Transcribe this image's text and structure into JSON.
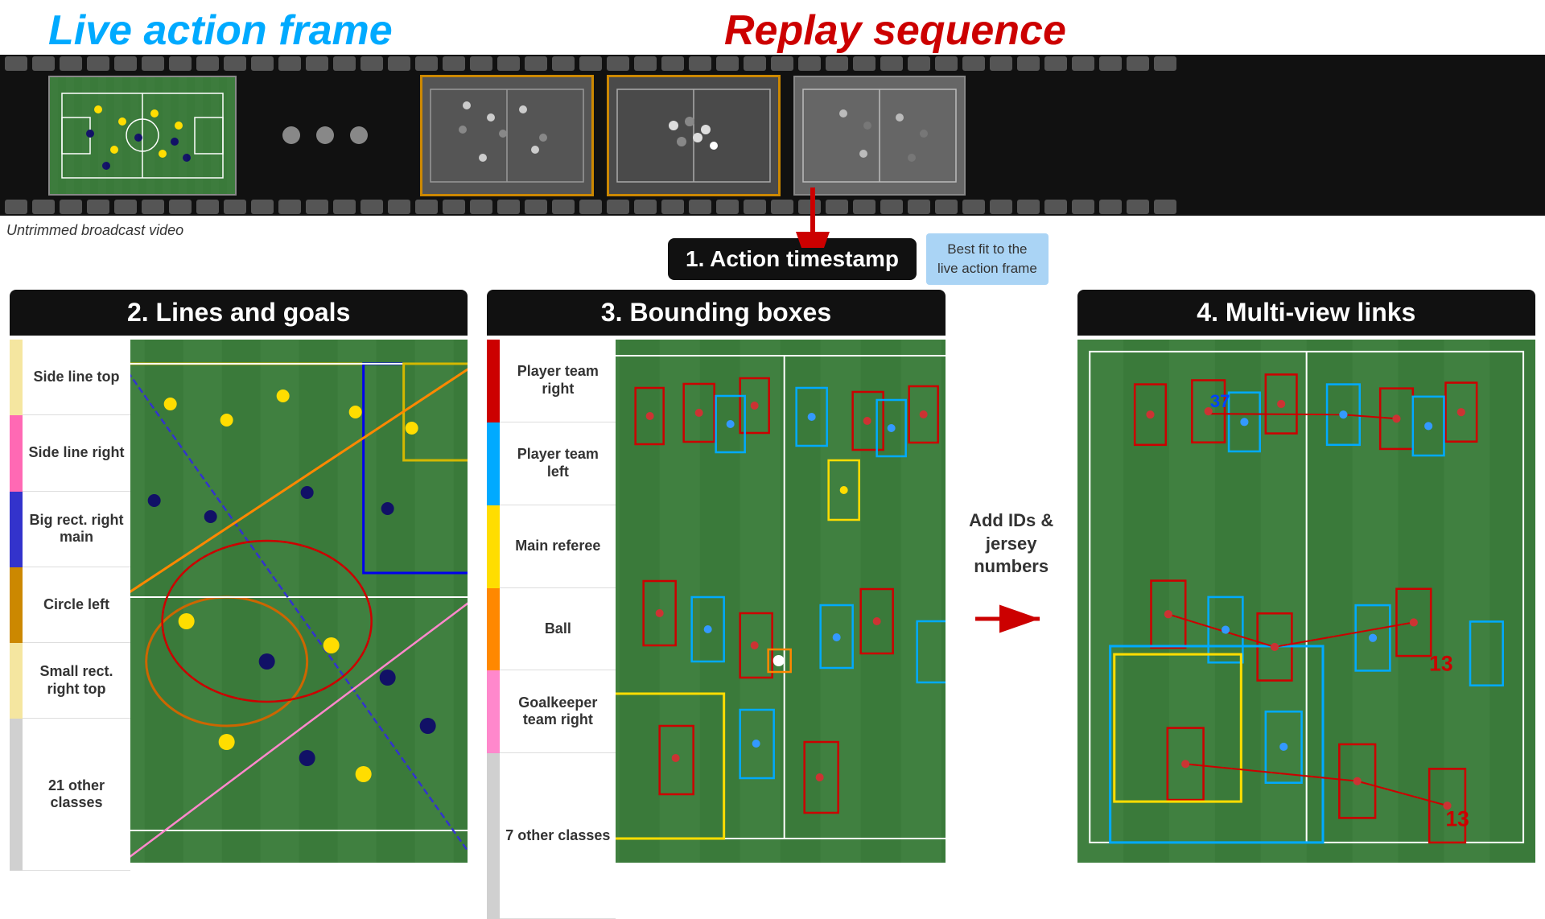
{
  "titles": {
    "live_action": "Live action frame",
    "replay_sequence": "Replay sequence",
    "untrimmed_label": "Untrimmed broadcast video"
  },
  "steps": {
    "step1": "1. Action timestamp",
    "step1_desc_line1": "Best fit to the",
    "step1_desc_line2": "live action frame",
    "step2": "2. Lines and goals",
    "step3": "3. Bounding boxes",
    "step4": "4. Multi-view links"
  },
  "panel1_legend": [
    {
      "color": "#f5e6a0",
      "text": "Side line top"
    },
    {
      "color": "#ff69b4",
      "text": "Side line right"
    },
    {
      "color": "#3333cc",
      "text": "Big rect. right main"
    },
    {
      "color": "#e8c88a",
      "text": "Circle left"
    },
    {
      "color": "#f5e6a0",
      "text": "Small rect. right top"
    },
    {
      "color": "#d0d0d0",
      "text": "21 other classes"
    }
  ],
  "panel2_legend": [
    {
      "color": "#cc0000",
      "text": "Player team right"
    },
    {
      "color": "#00aaff",
      "text": "Player team left"
    },
    {
      "color": "#ffdd00",
      "text": "Main referee"
    },
    {
      "color": "#ff8800",
      "text": "Ball"
    },
    {
      "color": "#ff88cc",
      "text": "Goalkeeper team right"
    },
    {
      "color": "#d0d0d0",
      "text": "7 other classes"
    }
  ],
  "add_ids_text": "Add IDs & jersey numbers",
  "jersey_numbers": [
    "37",
    "13",
    "13"
  ]
}
